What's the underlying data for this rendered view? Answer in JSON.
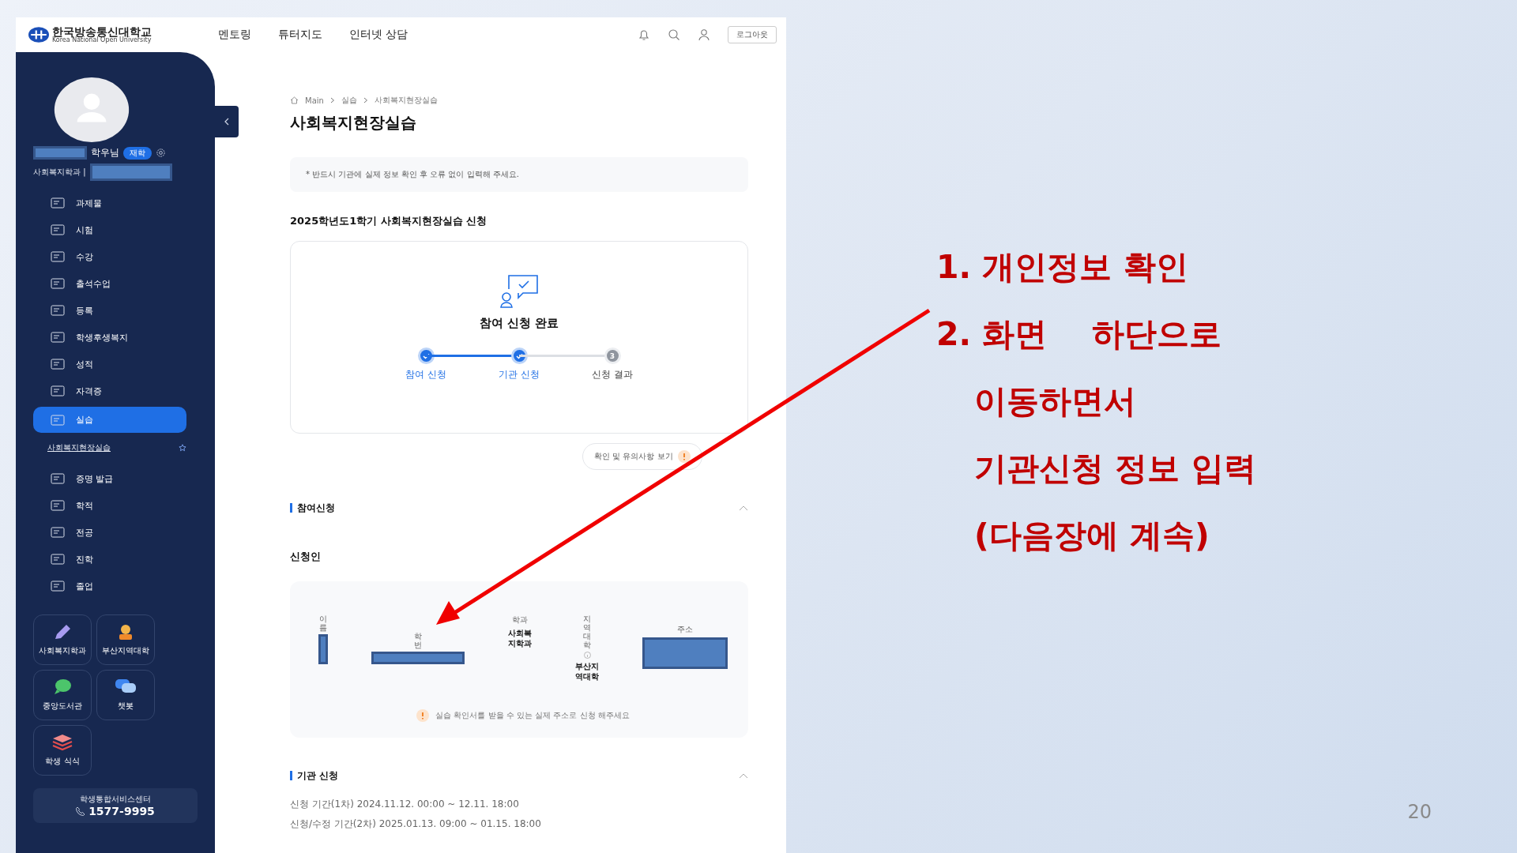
{
  "header": {
    "logo_text": "한국방송통신대학교",
    "logo_subtext": "Korea National Open University",
    "nav": [
      "멘토링",
      "튜터지도",
      "인터넷 상담"
    ],
    "logout": "로그아웃"
  },
  "sidebar": {
    "user_suffix": "학우님",
    "status_badge": "재학",
    "department": "사회복지학과 |",
    "menu": [
      {
        "label": "과제물",
        "kind": "item",
        "selected": false
      },
      {
        "label": "시험",
        "kind": "item",
        "selected": false
      },
      {
        "label": "수강",
        "kind": "item",
        "selected": false
      },
      {
        "label": "출석수업",
        "kind": "item",
        "selected": false
      },
      {
        "label": "등록",
        "kind": "item",
        "selected": false
      },
      {
        "label": "학생후생복지",
        "kind": "item",
        "selected": false
      },
      {
        "label": "성적",
        "kind": "item",
        "selected": false
      },
      {
        "label": "자격증",
        "kind": "item",
        "selected": false
      },
      {
        "label": "실습",
        "kind": "item",
        "selected": true
      },
      {
        "label": "사회복지현장실습",
        "kind": "sub",
        "selected": false
      },
      {
        "label": "증명 발급",
        "kind": "item",
        "selected": false
      },
      {
        "label": "학적",
        "kind": "item",
        "selected": false
      },
      {
        "label": "전공",
        "kind": "item",
        "selected": false
      },
      {
        "label": "진학",
        "kind": "item",
        "selected": false
      },
      {
        "label": "졸업",
        "kind": "item",
        "selected": false
      }
    ],
    "quick_links": [
      {
        "label": "사회복지학과",
        "kind": "pencil"
      },
      {
        "label": "부산지역대학",
        "kind": "person"
      },
      {
        "label": "중앙도서관",
        "kind": "bubble"
      },
      {
        "label": "챗봇",
        "kind": "bubbles"
      },
      {
        "label": "학생 식식",
        "kind": "layers"
      }
    ],
    "service_center": {
      "title": "학생통합서비스센터",
      "phone": "1577-9995"
    }
  },
  "main": {
    "breadcrumb": [
      "Main",
      "실습",
      "사회복지현장실습"
    ],
    "title": "사회복지현장실습",
    "notice": "* 반드시 기관에 실제 정보 확인 후 오류 없이 입력해 주세요.",
    "application_title": "2025학년도1학기 사회복지현장실습 신청",
    "status": {
      "heading": "참여 신청 완료",
      "steps": [
        {
          "label": "참여 신청",
          "done": true
        },
        {
          "label": "기관 신청",
          "done": true
        },
        {
          "label": "신청 결과",
          "done": false,
          "number": "3"
        }
      ]
    },
    "guide_button": "확인 및 유의사항 보기",
    "participation": {
      "title": "참여신청",
      "expanded": true,
      "applicant_title": "신청인",
      "fields": [
        {
          "label": "이름",
          "redacted": true
        },
        {
          "label": "학번",
          "redacted": true
        },
        {
          "label": "학과",
          "value": "사회복지학과"
        },
        {
          "label": "지역대학",
          "value": "부산지역대학",
          "info": true
        },
        {
          "label": "주소",
          "redacted": true
        }
      ],
      "hint": "실습 확인서를 받을 수 있는 실제 주소로 신청 해주세요"
    },
    "institution": {
      "title": "기관 신청",
      "expanded": true,
      "periods": [
        "신청 기간(1차) 2024.11.12. 00:00 ~ 12.11. 18:00",
        "신청/수정 기간(2차) 2025.01.13. 09:00 ~ 01.15. 18:00"
      ]
    }
  },
  "slide": {
    "notes": [
      "1. 개인정보 확인",
      "2. 화면    하단으로",
      "이동하면서",
      "기관신청 정보 입력",
      "(다음장에 계속)"
    ],
    "page_number": "20"
  }
}
